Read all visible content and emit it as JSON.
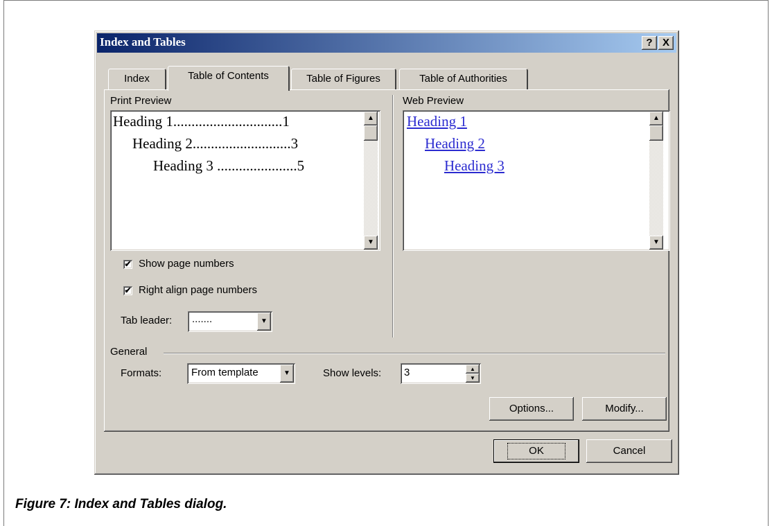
{
  "window": {
    "title": "Index and Tables",
    "help_label": "?",
    "close_label": "X"
  },
  "tabs": [
    {
      "label": "Index",
      "active": false
    },
    {
      "label": "Table of Contents",
      "active": true
    },
    {
      "label": "Table of Figures",
      "active": false
    },
    {
      "label": "Table of Authorities",
      "active": false
    }
  ],
  "print_preview": {
    "label": "Print Preview",
    "lines": [
      "Heading 1..............................1",
      "Heading 2...........................3",
      "Heading 3 ......................5"
    ]
  },
  "web_preview": {
    "label": "Web Preview",
    "links": [
      "Heading 1",
      "Heading 2",
      "Heading 3"
    ],
    "link_color": "#2b2bd0"
  },
  "options": {
    "show_page_numbers": {
      "label": "Show page numbers",
      "checked": true
    },
    "right_align": {
      "label": "Right align page numbers",
      "checked": true
    },
    "tab_leader": {
      "label": "Tab leader:",
      "value": "......."
    }
  },
  "general": {
    "label": "General",
    "formats_label": "Formats:",
    "formats_value": "From template",
    "show_levels_label": "Show levels:",
    "show_levels_value": "3"
  },
  "buttons": {
    "options": "Options...",
    "modify": "Modify...",
    "ok": "OK",
    "cancel": "Cancel"
  },
  "caption": "Figure 7: Index and Tables dialog.",
  "colors": {
    "dialog_bg": "#d4d0c8",
    "title_start": "#0a246a",
    "title_end": "#a6caf0"
  }
}
